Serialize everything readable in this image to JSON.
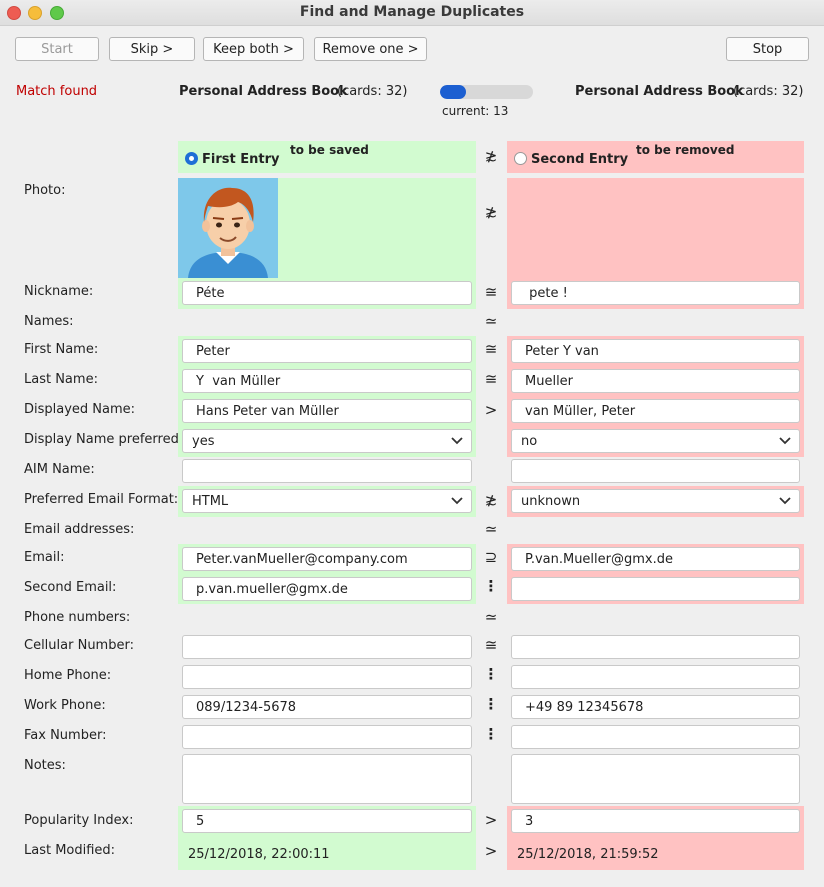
{
  "window": {
    "title": "Find and Manage Duplicates"
  },
  "toolbar": {
    "start_label": "Start",
    "skip_label": "Skip >",
    "keep_both_label": "Keep both >",
    "remove_one_label": "Remove one >",
    "stop_label": "Stop"
  },
  "status": {
    "match_text": "Match found",
    "match_color": "#c00000"
  },
  "books": {
    "left_name": "Personal Address Book",
    "left_count": "(cards: 32)",
    "right_name": "Personal Address Book",
    "right_count": "(cards: 32)"
  },
  "progress": {
    "fraction": 0.28,
    "label": "current: 13",
    "color": "#1c5fd1"
  },
  "headers": {
    "left_entry": "First Entry",
    "left_action": "to be saved",
    "right_entry": "Second Entry",
    "right_action": "to be removed",
    "relation": "≵"
  },
  "labels": {
    "photo": "Photo:",
    "nickname": "Nickname:",
    "names": "Names:",
    "first_name": "First Name:",
    "last_name": "Last Name:",
    "displayed_name": "Displayed Name:",
    "display_name_preferred": "Display Name preferred:",
    "aim_name": "AIM Name:",
    "preferred_email_format": "Preferred Email Format:",
    "email_addresses": "Email addresses:",
    "email": "Email:",
    "second_email": "Second Email:",
    "phone_numbers": "Phone numbers:",
    "cellular_number": "Cellular Number:",
    "home_phone": "Home Phone:",
    "work_phone": "Work Phone:",
    "fax_number": "Fax Number:",
    "notes": "Notes:",
    "popularity_index": "Popularity Index:",
    "last_modified": "Last Modified:"
  },
  "relations": {
    "photo": "≵",
    "nickname": "≅",
    "names": "≃",
    "first_name": "≅",
    "last_name": "≅",
    "displayed_name": ">",
    "preferred_email_format": "≵",
    "email_addresses": "≃",
    "email": "⊇",
    "second_email": "⋮",
    "phone_numbers": "≃",
    "cellular_number": "≅",
    "home_phone": "⋮",
    "work_phone": "⋮",
    "fax_number": "⋮",
    "popularity_index": ">",
    "last_modified": ">"
  },
  "left": {
    "nickname": "Péte",
    "first_name": "Peter",
    "last_name": "Y  van Müller",
    "displayed_name": "Hans Peter van Müller",
    "display_name_preferred": "yes",
    "aim_name": "",
    "preferred_email_format": "HTML",
    "email": "Peter.vanMueller@company.com",
    "second_email": "p.van.mueller@gmx.de",
    "cellular_number": "",
    "home_phone": "",
    "work_phone": "089/1234-5678",
    "fax_number": "",
    "notes": "",
    "popularity_index": "5",
    "last_modified": "25/12/2018, 22:00:11"
  },
  "right": {
    "nickname": " pete !",
    "first_name": "Peter Y van",
    "last_name": "Mueller",
    "displayed_name": "van Müller, Peter",
    "display_name_preferred": "no",
    "aim_name": "",
    "preferred_email_format": "unknown",
    "email": "P.van.Mueller@gmx.de",
    "second_email": "",
    "cellular_number": "",
    "home_phone": "",
    "work_phone": "+49 89 12345678",
    "fax_number": "",
    "notes": "",
    "popularity_index": "3",
    "last_modified": "25/12/2018, 21:59:52"
  },
  "colors": {
    "saved_bg": "#d2fbd0",
    "removed_bg": "#ffc2c2"
  },
  "icons": {
    "dropdown": "chevron-down-icon",
    "photo": "avatar-cartoon-man"
  }
}
